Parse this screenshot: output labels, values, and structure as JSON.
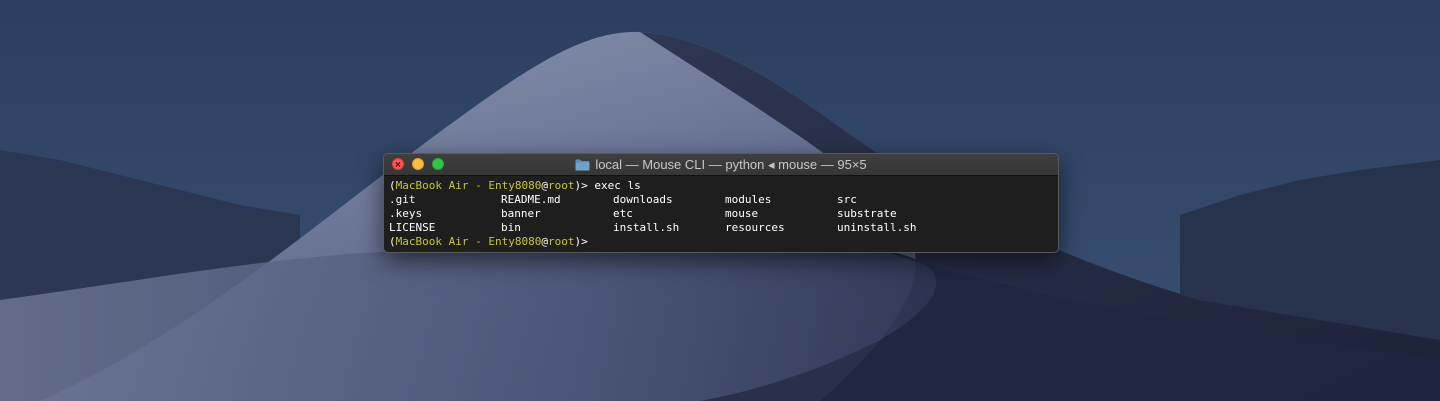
{
  "window": {
    "title": "local — Mouse CLI — python ◂ mouse — 95×5",
    "folder_icon": "folder-icon"
  },
  "terminal": {
    "prompt": {
      "open": "(",
      "host": "MacBook Air - Enty8080",
      "at": "@",
      "user": "root",
      "close": ")> "
    },
    "command": "exec ls",
    "listing": [
      [
        ".git",
        "README.md",
        "downloads",
        "modules",
        "src"
      ],
      [
        ".keys",
        "banner",
        "etc",
        "mouse",
        "substrate"
      ],
      [
        "LICENSE",
        "bin",
        "install.sh",
        "resources",
        "uninstall.sh"
      ]
    ]
  },
  "colors": {
    "prompt": "#c6c73a",
    "close": "#fc5753",
    "minimize": "#fdbc40",
    "zoom": "#33c748"
  }
}
